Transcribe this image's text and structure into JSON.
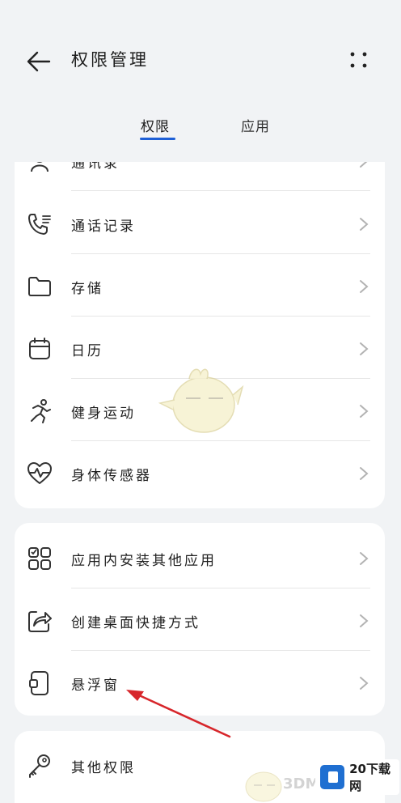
{
  "header": {
    "title": "权限管理",
    "back_icon": "arrow-left-icon",
    "more_icon": "more-dots-icon"
  },
  "tabs": [
    {
      "label": "权限",
      "active": true
    },
    {
      "label": "应用",
      "active": false
    }
  ],
  "colors": {
    "accent": "#1d5fd6",
    "background": "#f1f3f5",
    "card": "#ffffff",
    "annotation_arrow": "#d7262b"
  },
  "permissions_group1": [
    {
      "label": "通讯录",
      "icon": "contacts-icon"
    },
    {
      "label": "通话记录",
      "icon": "call-log-icon"
    },
    {
      "label": "存储",
      "icon": "folder-icon"
    },
    {
      "label": "日历",
      "icon": "calendar-icon"
    },
    {
      "label": "健身运动",
      "icon": "running-icon"
    },
    {
      "label": "身体传感器",
      "icon": "heart-rate-icon"
    }
  ],
  "permissions_group2": [
    {
      "label": "应用内安装其他应用",
      "icon": "apps-grid-icon"
    },
    {
      "label": "创建桌面快捷方式",
      "icon": "shortcut-icon"
    },
    {
      "label": "悬浮窗",
      "icon": "floating-window-icon"
    }
  ],
  "permissions_group3": [
    {
      "label": "其他权限",
      "icon": "key-icon"
    }
  ],
  "watermark": {
    "site": "20下载网",
    "brand": "3DM"
  }
}
